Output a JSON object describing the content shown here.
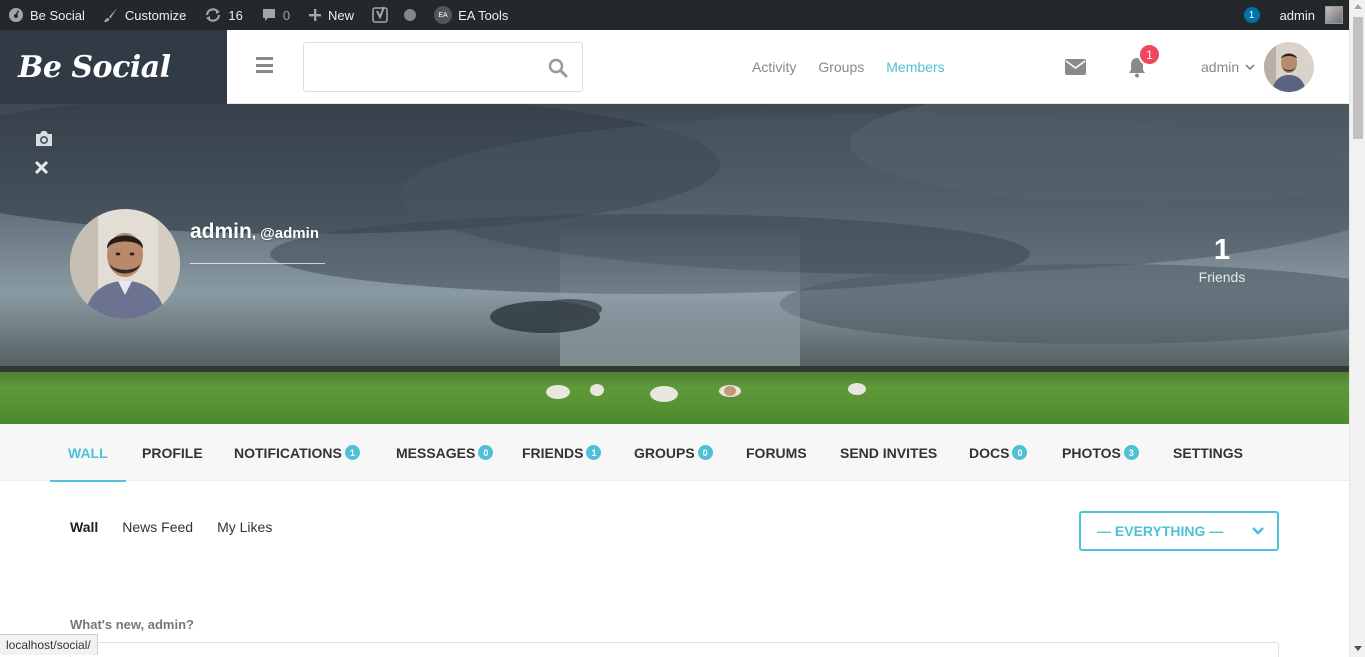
{
  "adminbar": {
    "site_name": "Be Social",
    "customize": "Customize",
    "updates_count": "16",
    "comments_count": "0",
    "new_label": "New",
    "ea_tools": "EA Tools",
    "ea_badge": "EA",
    "notif_count": "1",
    "user": "admin"
  },
  "header": {
    "logo": "Be Social",
    "search_placeholder": "",
    "nav": [
      "Activity",
      "Groups",
      "Members"
    ],
    "active_nav": "Members",
    "bell_count": "1",
    "user": "admin"
  },
  "profile": {
    "name": "admin",
    "handle": ", @admin",
    "friends_count": "1",
    "friends_label": "Friends"
  },
  "tabs": [
    {
      "label": "WALL",
      "count": null,
      "active": true
    },
    {
      "label": "PROFILE",
      "count": null
    },
    {
      "label": "NOTIFICATIONS",
      "count": "1"
    },
    {
      "label": "MESSAGES",
      "count": "0"
    },
    {
      "label": "FRIENDS",
      "count": "1"
    },
    {
      "label": "GROUPS",
      "count": "0"
    },
    {
      "label": "FORUMS",
      "count": null
    },
    {
      "label": "SEND INVITES",
      "count": null
    },
    {
      "label": "DOCS",
      "count": "0"
    },
    {
      "label": "PHOTOS",
      "count": "3"
    },
    {
      "label": "SETTINGS",
      "count": null
    }
  ],
  "subnav": [
    "Wall",
    "News Feed",
    "My Likes"
  ],
  "filter": {
    "selected": "— EVERYTHING —"
  },
  "composer": {
    "prompt": "What's new, admin?"
  },
  "status_url": "localhost/social/",
  "colors": {
    "accent": "#4fc1d6",
    "adminbar": "#23282d",
    "logo_bg": "#313b46",
    "badge_red": "#f0475c"
  }
}
